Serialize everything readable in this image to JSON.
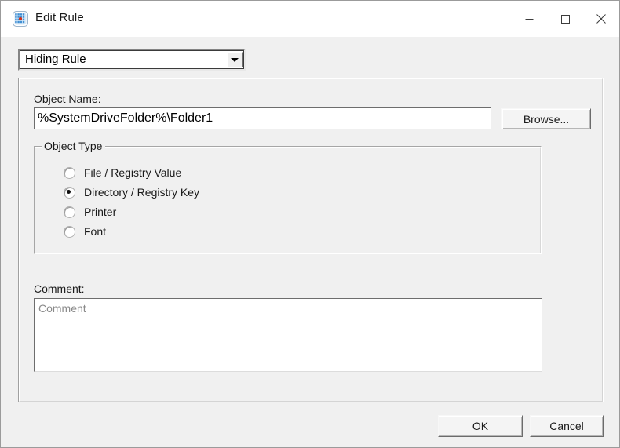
{
  "window": {
    "title": "Edit Rule",
    "icon": "globe-grid-icon",
    "controls": {
      "minimize": "minimize-icon",
      "maximize": "maximize-icon",
      "close": "close-icon"
    }
  },
  "rule_type": {
    "selected": "Hiding Rule",
    "options": [
      "Hiding Rule"
    ]
  },
  "object_name": {
    "label": "Object Name:",
    "value": "%SystemDriveFolder%\\Folder1",
    "placeholder": "",
    "browse_label": "Browse..."
  },
  "object_type": {
    "legend": "Object Type",
    "selected_index": 1,
    "options": [
      "File / Registry Value",
      "Directory / Registry Key",
      "Printer",
      "Font"
    ]
  },
  "comment": {
    "label": "Comment:",
    "value": "",
    "placeholder": "Comment"
  },
  "footer": {
    "ok_label": "OK",
    "cancel_label": "Cancel"
  },
  "colors": {
    "dialog_background": "#f0f0f0",
    "titlebar_background": "#ffffff",
    "field_background": "#ffffff",
    "text": "#1a1a1a",
    "placeholder_text": "#8a8a8a",
    "icon_blue": "#2f7fd1",
    "icon_red": "#d4301a",
    "close_hover": "#e81123"
  }
}
